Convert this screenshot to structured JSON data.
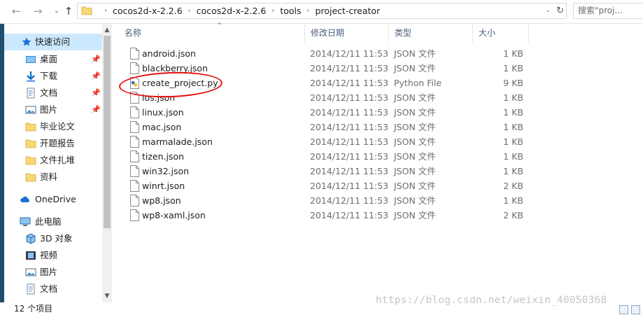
{
  "address": {
    "crumbs": [
      "cocos2d-x-2.2.6",
      "cocos2d-x-2.2.6",
      "tools",
      "project-creator"
    ],
    "search_placeholder": "搜索\"proj..."
  },
  "nav": {
    "quick_access": "快速访问",
    "items": [
      {
        "label": "桌面",
        "icon": "desktop-icon",
        "pinned": true
      },
      {
        "label": "下载",
        "icon": "download-icon",
        "pinned": true
      },
      {
        "label": "文档",
        "icon": "documents-icon",
        "pinned": true
      },
      {
        "label": "图片",
        "icon": "pictures-icon",
        "pinned": true
      },
      {
        "label": "毕业论文",
        "icon": "folder-icon",
        "pinned": false
      },
      {
        "label": "开题报告",
        "icon": "folder-icon",
        "pinned": false
      },
      {
        "label": "文件扎堆",
        "icon": "folder-icon",
        "pinned": false
      },
      {
        "label": "资料",
        "icon": "folder-icon",
        "pinned": false
      }
    ],
    "onedrive": "OneDrive",
    "this_pc": "此电脑",
    "pc_items": [
      {
        "label": "3D 对象",
        "icon": "3d-objects-icon"
      },
      {
        "label": "视频",
        "icon": "videos-icon"
      },
      {
        "label": "图片",
        "icon": "pictures-icon"
      },
      {
        "label": "文档",
        "icon": "documents-icon"
      }
    ]
  },
  "columns": {
    "name": "名称",
    "date": "修改日期",
    "type": "类型",
    "size": "大小"
  },
  "files": [
    {
      "name": "android.json",
      "date": "2014/12/11 11:53",
      "type": "JSON 文件",
      "size": "1 KB"
    },
    {
      "name": "blackberry.json",
      "date": "2014/12/11 11:53",
      "type": "JSON 文件",
      "size": "1 KB"
    },
    {
      "name": "create_project.py",
      "date": "2014/12/11 11:53",
      "type": "Python File",
      "size": "9 KB"
    },
    {
      "name": "ios.json",
      "date": "2014/12/11 11:53",
      "type": "JSON 文件",
      "size": "1 KB"
    },
    {
      "name": "linux.json",
      "date": "2014/12/11 11:53",
      "type": "JSON 文件",
      "size": "1 KB"
    },
    {
      "name": "mac.json",
      "date": "2014/12/11 11:53",
      "type": "JSON 文件",
      "size": "1 KB"
    },
    {
      "name": "marmalade.json",
      "date": "2014/12/11 11:53",
      "type": "JSON 文件",
      "size": "1 KB"
    },
    {
      "name": "tizen.json",
      "date": "2014/12/11 11:53",
      "type": "JSON 文件",
      "size": "1 KB"
    },
    {
      "name": "win32.json",
      "date": "2014/12/11 11:53",
      "type": "JSON 文件",
      "size": "1 KB"
    },
    {
      "name": "winrt.json",
      "date": "2014/12/11 11:53",
      "type": "JSON 文件",
      "size": "2 KB"
    },
    {
      "name": "wp8.json",
      "date": "2014/12/11 11:53",
      "type": "JSON 文件",
      "size": "1 KB"
    },
    {
      "name": "wp8-xaml.json",
      "date": "2014/12/11 11:53",
      "type": "JSON 文件",
      "size": "2 KB"
    }
  ],
  "status": {
    "count": "12 个项目"
  },
  "watermark": "https://blog.csdn.net/weixin_40050368",
  "colors": {
    "selection": "#cce8ff",
    "annotation": "#e60f0f",
    "folder": "#f8d775"
  }
}
